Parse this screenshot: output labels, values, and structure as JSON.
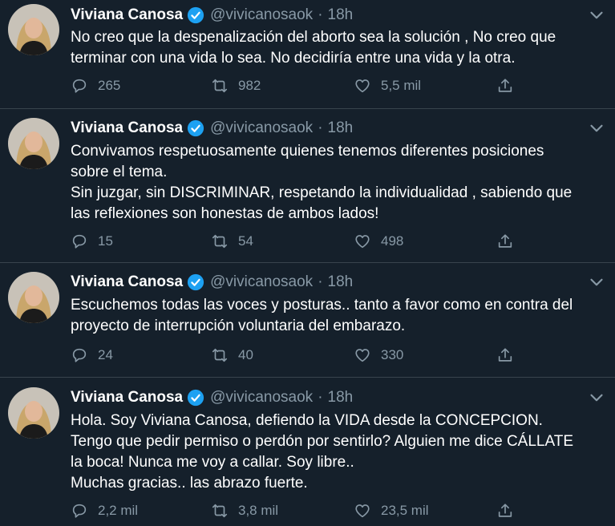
{
  "tweets": [
    {
      "name": "Viviana Canosa",
      "handle": "@vivicanosaok",
      "time": "18h",
      "lines": [
        "No creo que la despenalización del aborto sea la solución , No creo que",
        "terminar con una vida lo sea. No decidiría entre una vida y la otra."
      ],
      "replies": "265",
      "retweets": "982",
      "likes": "5,5 mil"
    },
    {
      "name": "Viviana Canosa",
      "handle": "@vivicanosaok",
      "time": "18h",
      "lines": [
        "Convivamos respetuosamente quienes tenemos diferentes posiciones",
        "sobre el tema.",
        "Sin juzgar, sin DISCRIMINAR, respetando la individualidad , sabiendo que",
        "las reflexiones son honestas de ambos lados!"
      ],
      "replies": "15",
      "retweets": "54",
      "likes": "498"
    },
    {
      "name": "Viviana Canosa",
      "handle": "@vivicanosaok",
      "time": "18h",
      "lines": [
        "Escuchemos todas las voces y posturas.. tanto a favor como en contra del",
        "proyecto de interrupción voluntaria del embarazo."
      ],
      "replies": "24",
      "retweets": "40",
      "likes": "330"
    },
    {
      "name": "Viviana Canosa",
      "handle": "@vivicanosaok",
      "time": "18h",
      "lines": [
        "Hola. Soy Viviana Canosa, defiendo la VIDA desde la CONCEPCION.",
        "Tengo que pedir permiso o perdón por sentirlo? Alguien me dice CÁLLATE",
        "la boca! Nunca me voy a callar. Soy libre..",
        "Muchas gracias.. las abrazo fuerte."
      ],
      "replies": "2,2 mil",
      "retweets": "3,8 mil",
      "likes": "23,5 mil"
    }
  ],
  "colors": {
    "background": "#15202b",
    "secondary_text": "#8899a6",
    "verified": "#1da1f2",
    "divider": "#38444d"
  },
  "icons": {
    "reply": "reply-icon",
    "retweet": "retweet-icon",
    "like": "heart-icon",
    "share": "share-icon",
    "verified": "verified-badge-icon",
    "caret": "chevron-down-icon"
  }
}
